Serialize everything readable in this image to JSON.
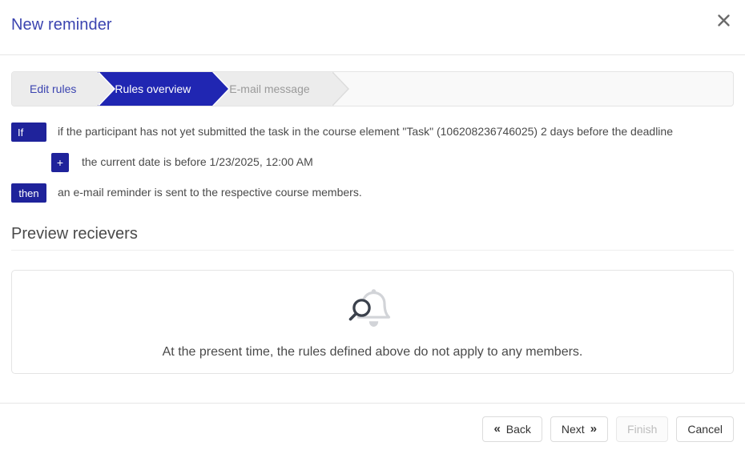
{
  "header": {
    "title": "New reminder",
    "close_icon": "close-icon"
  },
  "steps": [
    {
      "label": "Edit rules",
      "state": "done"
    },
    {
      "label": "Rules overview",
      "state": "active"
    },
    {
      "label": "E-mail message",
      "state": "upcoming"
    }
  ],
  "rules": {
    "if_badge": "If",
    "if_text": "if the participant has not yet submitted the task in the course element \"Task\" (106208236746025) 2 days before the deadline",
    "plus_badge": "+",
    "and_text": "the current date is before 1/23/2025, 12:00 AM",
    "then_badge": "then",
    "then_text": "an e-mail reminder is sent to the respective course members."
  },
  "preview": {
    "heading": "Preview recievers",
    "empty_icon": "bell-search-icon",
    "empty_text": "At the present time, the rules defined above do not apply to any members."
  },
  "footer": {
    "back_label": "Back",
    "back_icon": "chevron-double-left-icon",
    "next_label": "Next",
    "next_icon": "chevron-double-right-icon",
    "finish_label": "Finish",
    "cancel_label": "Cancel"
  },
  "colors": {
    "accent_blue": "#2026b2",
    "badge_blue": "#1f239b",
    "title_blue": "#3b44b0",
    "step_done_bg": "#ececec",
    "bell_gray": "#d2d4d8",
    "magnifier_dark": "#3b414c"
  }
}
